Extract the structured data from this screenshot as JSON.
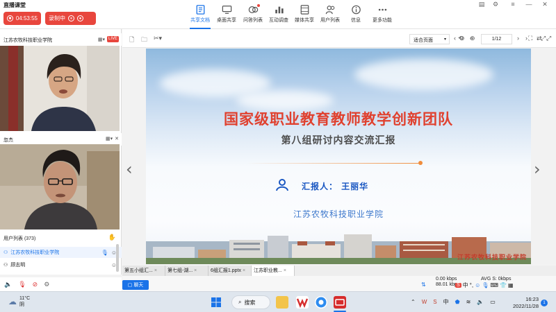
{
  "app": {
    "title": "直播课堂"
  },
  "status": {
    "timer": "04:53:55",
    "recording_label": "录制中"
  },
  "toolbar": {
    "items": [
      {
        "label": "共享文档",
        "icon": "share-doc-icon",
        "active": true
      },
      {
        "label": "桌面共享",
        "icon": "desktop-share-icon"
      },
      {
        "label": "问答列表",
        "icon": "qa-list-icon"
      },
      {
        "label": "互动调查",
        "icon": "survey-icon"
      },
      {
        "label": "媒体共享",
        "icon": "media-share-icon"
      },
      {
        "label": "用户列表",
        "icon": "user-list-icon"
      },
      {
        "label": "信息",
        "icon": "info-icon"
      },
      {
        "label": "更多功能",
        "icon": "more-icon"
      }
    ]
  },
  "cameras": [
    {
      "name": "江苏农牧科技职业学院",
      "badge": "LIVE"
    },
    {
      "name": "忽杰"
    }
  ],
  "user_list": {
    "header": "用户列表 (373)",
    "users": [
      {
        "name": "江苏农牧科技职业学院",
        "highlight": true
      },
      {
        "name": "顾志明"
      }
    ]
  },
  "doc_view": {
    "zoom_mode": "适合页面",
    "page": "1/12"
  },
  "slide": {
    "title": "国家级职业教育教师教学创新团队",
    "subtitle": "第八组研讨内容交流汇报",
    "reporter": "汇报人：  王丽华",
    "school": "江苏农牧科技职业学院",
    "watermark": "江苏农牧科技职业学院"
  },
  "tabs": [
    "第五小组汇...",
    "第七组-湖...",
    "6组汇报1.pptx",
    "江苏职业教..."
  ],
  "chat": {
    "button_label": "聊天"
  },
  "network": {
    "upload": "0.00 kbps",
    "download": "88.01 kbps",
    "avg": "AVG S: 0kbps"
  },
  "taskbar": {
    "weather_temp": "11°C",
    "weather_desc": "阴",
    "search_label": "搜索",
    "ime": "中",
    "time": "16:23",
    "date": "2022/11/28",
    "notifications": "1"
  },
  "colors": {
    "accent": "#1a73e8",
    "record_red": "#e8463d",
    "title_red": "#e0412f"
  }
}
